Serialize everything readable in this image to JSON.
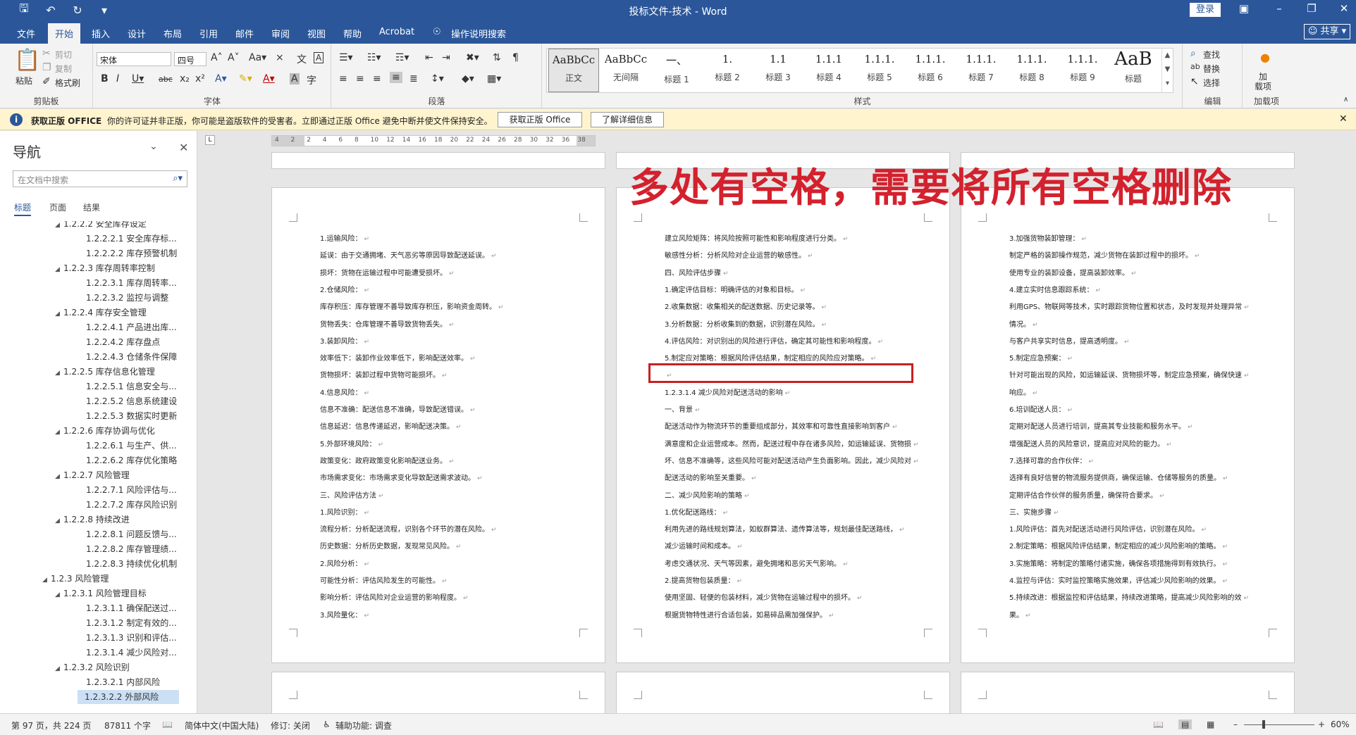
{
  "window": {
    "title": "投标文件-技术  -  Word",
    "login": "登录",
    "share": "共享"
  },
  "qat": [
    "save-icon",
    "undo-icon",
    "redo-icon",
    "customize-icon"
  ],
  "tabs": [
    "文件",
    "开始",
    "插入",
    "设计",
    "布局",
    "引用",
    "邮件",
    "审阅",
    "视图",
    "帮助",
    "Acrobat",
    "操作说明搜索"
  ],
  "ribbon": {
    "clipboard": {
      "label": "剪贴板",
      "paste": "粘贴",
      "cut": "剪切",
      "copy": "复制",
      "format_painter": "格式刷"
    },
    "font": {
      "label": "字体",
      "name": "宋体",
      "size": "四号"
    },
    "paragraph": {
      "label": "段落"
    },
    "styles": {
      "label": "样式",
      "items": [
        {
          "preview": "AaBbCc",
          "name": "正文"
        },
        {
          "preview": "AaBbCc",
          "name": "无间隔"
        },
        {
          "preview": "一、",
          "name": "标题 1"
        },
        {
          "preview": "1.",
          "name": "标题 2"
        },
        {
          "preview": "1.1",
          "name": "标题 3"
        },
        {
          "preview": "1.1.1",
          "name": "标题 4"
        },
        {
          "preview": "1.1.1.",
          "name": "标题 5"
        },
        {
          "preview": "1.1.1.",
          "name": "标题 6"
        },
        {
          "preview": "1.1.1.",
          "name": "标题 7"
        },
        {
          "preview": "1.1.1.",
          "name": "标题 8"
        },
        {
          "preview": "1.1.1.",
          "name": "标题 9"
        },
        {
          "preview": "AaB",
          "name": "标题"
        }
      ]
    },
    "editing": {
      "label": "编辑",
      "find": "查找",
      "replace": "替换",
      "select": "选择"
    },
    "addins": {
      "label": "加载项",
      "button": "加\n载项"
    }
  },
  "message_bar": {
    "title": "获取正版 OFFICE",
    "text": "你的许可证并非正版，你可能是盗版软件的受害者。立即通过正版 Office 避免中断并使文件保持安全。",
    "btn_get": "获取正版 Office",
    "btn_learn": "了解详细信息"
  },
  "nav": {
    "title": "导航",
    "search_placeholder": "在文档中搜索",
    "tabs": [
      "标题",
      "页面",
      "结果"
    ],
    "tree": [
      {
        "text": "1.2.2.2 安全库存设定",
        "level": 3,
        "tri": true
      },
      {
        "text": "1.2.2.2.1 安全库存标...",
        "level": 4
      },
      {
        "text": "1.2.2.2.2 库存预警机制",
        "level": 4
      },
      {
        "text": "1.2.2.3 库存周转率控制",
        "level": 3,
        "tri": true
      },
      {
        "text": "1.2.2.3.1 库存周转率...",
        "level": 4
      },
      {
        "text": "1.2.2.3.2 监控与调整",
        "level": 4
      },
      {
        "text": "1.2.2.4 库存安全管理",
        "level": 3,
        "tri": true
      },
      {
        "text": "1.2.2.4.1 产品进出库...",
        "level": 4
      },
      {
        "text": "1.2.2.4.2 库存盘点",
        "level": 4
      },
      {
        "text": "1.2.2.4.3 仓储条件保障",
        "level": 4
      },
      {
        "text": "1.2.2.5 库存信息化管理",
        "level": 3,
        "tri": true
      },
      {
        "text": "1.2.2.5.1 信息安全与...",
        "level": 4
      },
      {
        "text": "1.2.2.5.2 信息系统建设",
        "level": 4
      },
      {
        "text": "1.2.2.5.3 数据实时更新",
        "level": 4
      },
      {
        "text": "1.2.2.6 库存协调与优化",
        "level": 3,
        "tri": true
      },
      {
        "text": "1.2.2.6.1 与生产、供...",
        "level": 4
      },
      {
        "text": "1.2.2.6.2 库存优化策略",
        "level": 4
      },
      {
        "text": "1.2.2.7 风险管理",
        "level": 3,
        "tri": true
      },
      {
        "text": "1.2.2.7.1 风险评估与...",
        "level": 4
      },
      {
        "text": "1.2.2.7.2 库存风险识别",
        "level": 4
      },
      {
        "text": "1.2.2.8 持续改进",
        "level": 3,
        "tri": true
      },
      {
        "text": "1.2.2.8.1 问题反馈与...",
        "level": 4
      },
      {
        "text": "1.2.2.8.2 库存管理绩...",
        "level": 4
      },
      {
        "text": "1.2.2.8.3 持续优化机制",
        "level": 4
      },
      {
        "text": "1.2.3 风险管理",
        "level": 2,
        "tri": true
      },
      {
        "text": "1.2.3.1 风险管理目标",
        "level": 3,
        "tri": true
      },
      {
        "text": "1.2.3.1.1 确保配送过...",
        "level": 4
      },
      {
        "text": "1.2.3.1.2 制定有效的...",
        "level": 4
      },
      {
        "text": "1.2.3.1.3 识别和评估...",
        "level": 4
      },
      {
        "text": "1.2.3.1.4 减少风险对...",
        "level": 4
      },
      {
        "text": "1.2.3.2 风险识别",
        "level": 3,
        "tri": true
      },
      {
        "text": "1.2.3.2.1 内部风险",
        "level": 4
      },
      {
        "text": "1.2.3.2.2 外部风险",
        "level": 4,
        "selected": true
      }
    ]
  },
  "ruler": [
    "4",
    "2",
    "2",
    "4",
    "6",
    "8",
    "10",
    "12",
    "14",
    "16",
    "18",
    "20",
    "22",
    "24",
    "26",
    "28",
    "30",
    "32",
    "36",
    "38"
  ],
  "annotation": "多处有空格，需要将所有空格删除",
  "pages": [
    {
      "lines": [
        "1.运输风险：",
        "延误：由于交通拥堵、天气恶劣等原因导致配送延误。",
        "损坏：货物在运输过程中可能遭受损坏。",
        "2.仓储风险：",
        "库存积压：库存管理不善导致库存积压，影响资金周转。",
        "货物丢失：仓库管理不善导致货物丢失。",
        "3.装卸风险：",
        "效率低下：装卸作业效率低下，影响配送效率。",
        "货物损坏：装卸过程中货物可能损坏。",
        "4.信息风险：",
        "信息不准确：配送信息不准确，导致配送错误。",
        "信息延迟：信息传递延迟，影响配送决策。",
        "5.外部环境风险：",
        "政策变化：政府政策变化影响配送业务。",
        "市场需求变化：市场需求变化导致配送需求波动。",
        "三、风险评估方法",
        "1.风险识别：",
        "流程分析：分析配送流程，识别各个环节的潜在风险。",
        "历史数据：分析历史数据，发现常见风险。",
        "2.风险分析：",
        "可能性分析：评估风险发生的可能性。",
        "影响分析：评估风险对企业运营的影响程度。",
        "3.风险量化："
      ]
    },
    {
      "lines": [
        "建立风险矩阵：将风险按照可能性和影响程度进行分类。",
        "敏感性分析：分析风险对企业运营的敏感性。",
        "四、风险评估步骤",
        "1.确定评估目标：明确评估的对象和目标。",
        "2.收集数据：收集相关的配送数据、历史记录等。",
        "3.分析数据：分析收集到的数据，识别潜在风险。",
        "4.评估风险：对识别出的风险进行评估，确定其可能性和影响程度。",
        "5.制定应对策略：根据风险评估结果，制定相应的风险应对策略。",
        "",
        "1.2.3.1.4    减少风险对配送活动的影响",
        "一、背景",
        "配送活动作为物流环节的重要组成部分，其效率和可靠性直接影响到客户",
        "满意度和企业运营成本。然而，配送过程中存在诸多风险，如运输延误、货物损",
        "坏、信息不准确等，这些风险可能对配送活动产生负面影响。因此，减少风险对",
        "配送活动的影响至关重要。",
        "二、减少风险影响的策略",
        "1.优化配送路线：",
        "利用先进的路线规划算法，如蚁群算法、遗传算法等，规划最佳配送路线，",
        "减少运输时间和成本。",
        "考虑交通状况、天气等因素，避免拥堵和恶劣天气影响。",
        "2.提高货物包装质量：",
        "使用坚固、轻便的包装材料，减少货物在运输过程中的损坏。",
        "根据货物特性进行合适包装，如易碎品需加强保护。"
      ]
    },
    {
      "lines": [
        "3.加强货物装卸管理：",
        "制定严格的装卸操作规范，减少货物在装卸过程中的损坏。",
        "使用专业的装卸设备，提高装卸效率。",
        "4.建立实时信息跟踪系统：",
        "利用GPS、物联网等技术，实时跟踪货物位置和状态，及时发现并处理异常",
        "情况。",
        "与客户共享实时信息，提高透明度。",
        "5.制定应急预案：",
        "针对可能出现的风险，如运输延误、货物损坏等，制定应急预案，确保快速",
        "响应。",
        "6.培训配送人员：",
        "定期对配送人员进行培训，提高其专业技能和服务水平。",
        "增强配送人员的风险意识，提高应对风险的能力。",
        "7.选择可靠的合作伙伴：",
        "选择有良好信誉的物流服务提供商，确保运输、仓储等服务的质量。",
        "定期评估合作伙伴的服务质量，确保符合要求。",
        "三、实施步骤",
        "1.风险评估：首先对配送活动进行风险评估，识别潜在风险。",
        "2.制定策略：根据风险评估结果，制定相应的减少风险影响的策略。",
        "3.实施策略：将制定的策略付诸实施，确保各项措施得到有效执行。",
        "4.监控与评估：实时监控策略实施效果，评估减少风险影响的效果。",
        "5.持续改进：根据监控和评估结果，持续改进策略，提高减少风险影响的效",
        "果。"
      ]
    }
  ],
  "status": {
    "page": "第 97 页，共 224 页",
    "words": "87811 个字",
    "language": "简体中文(中国大陆)",
    "track": "修订: 关闭",
    "accessibility": "辅助功能: 调查",
    "zoom": "60%",
    "zoom_level": 0.6
  }
}
